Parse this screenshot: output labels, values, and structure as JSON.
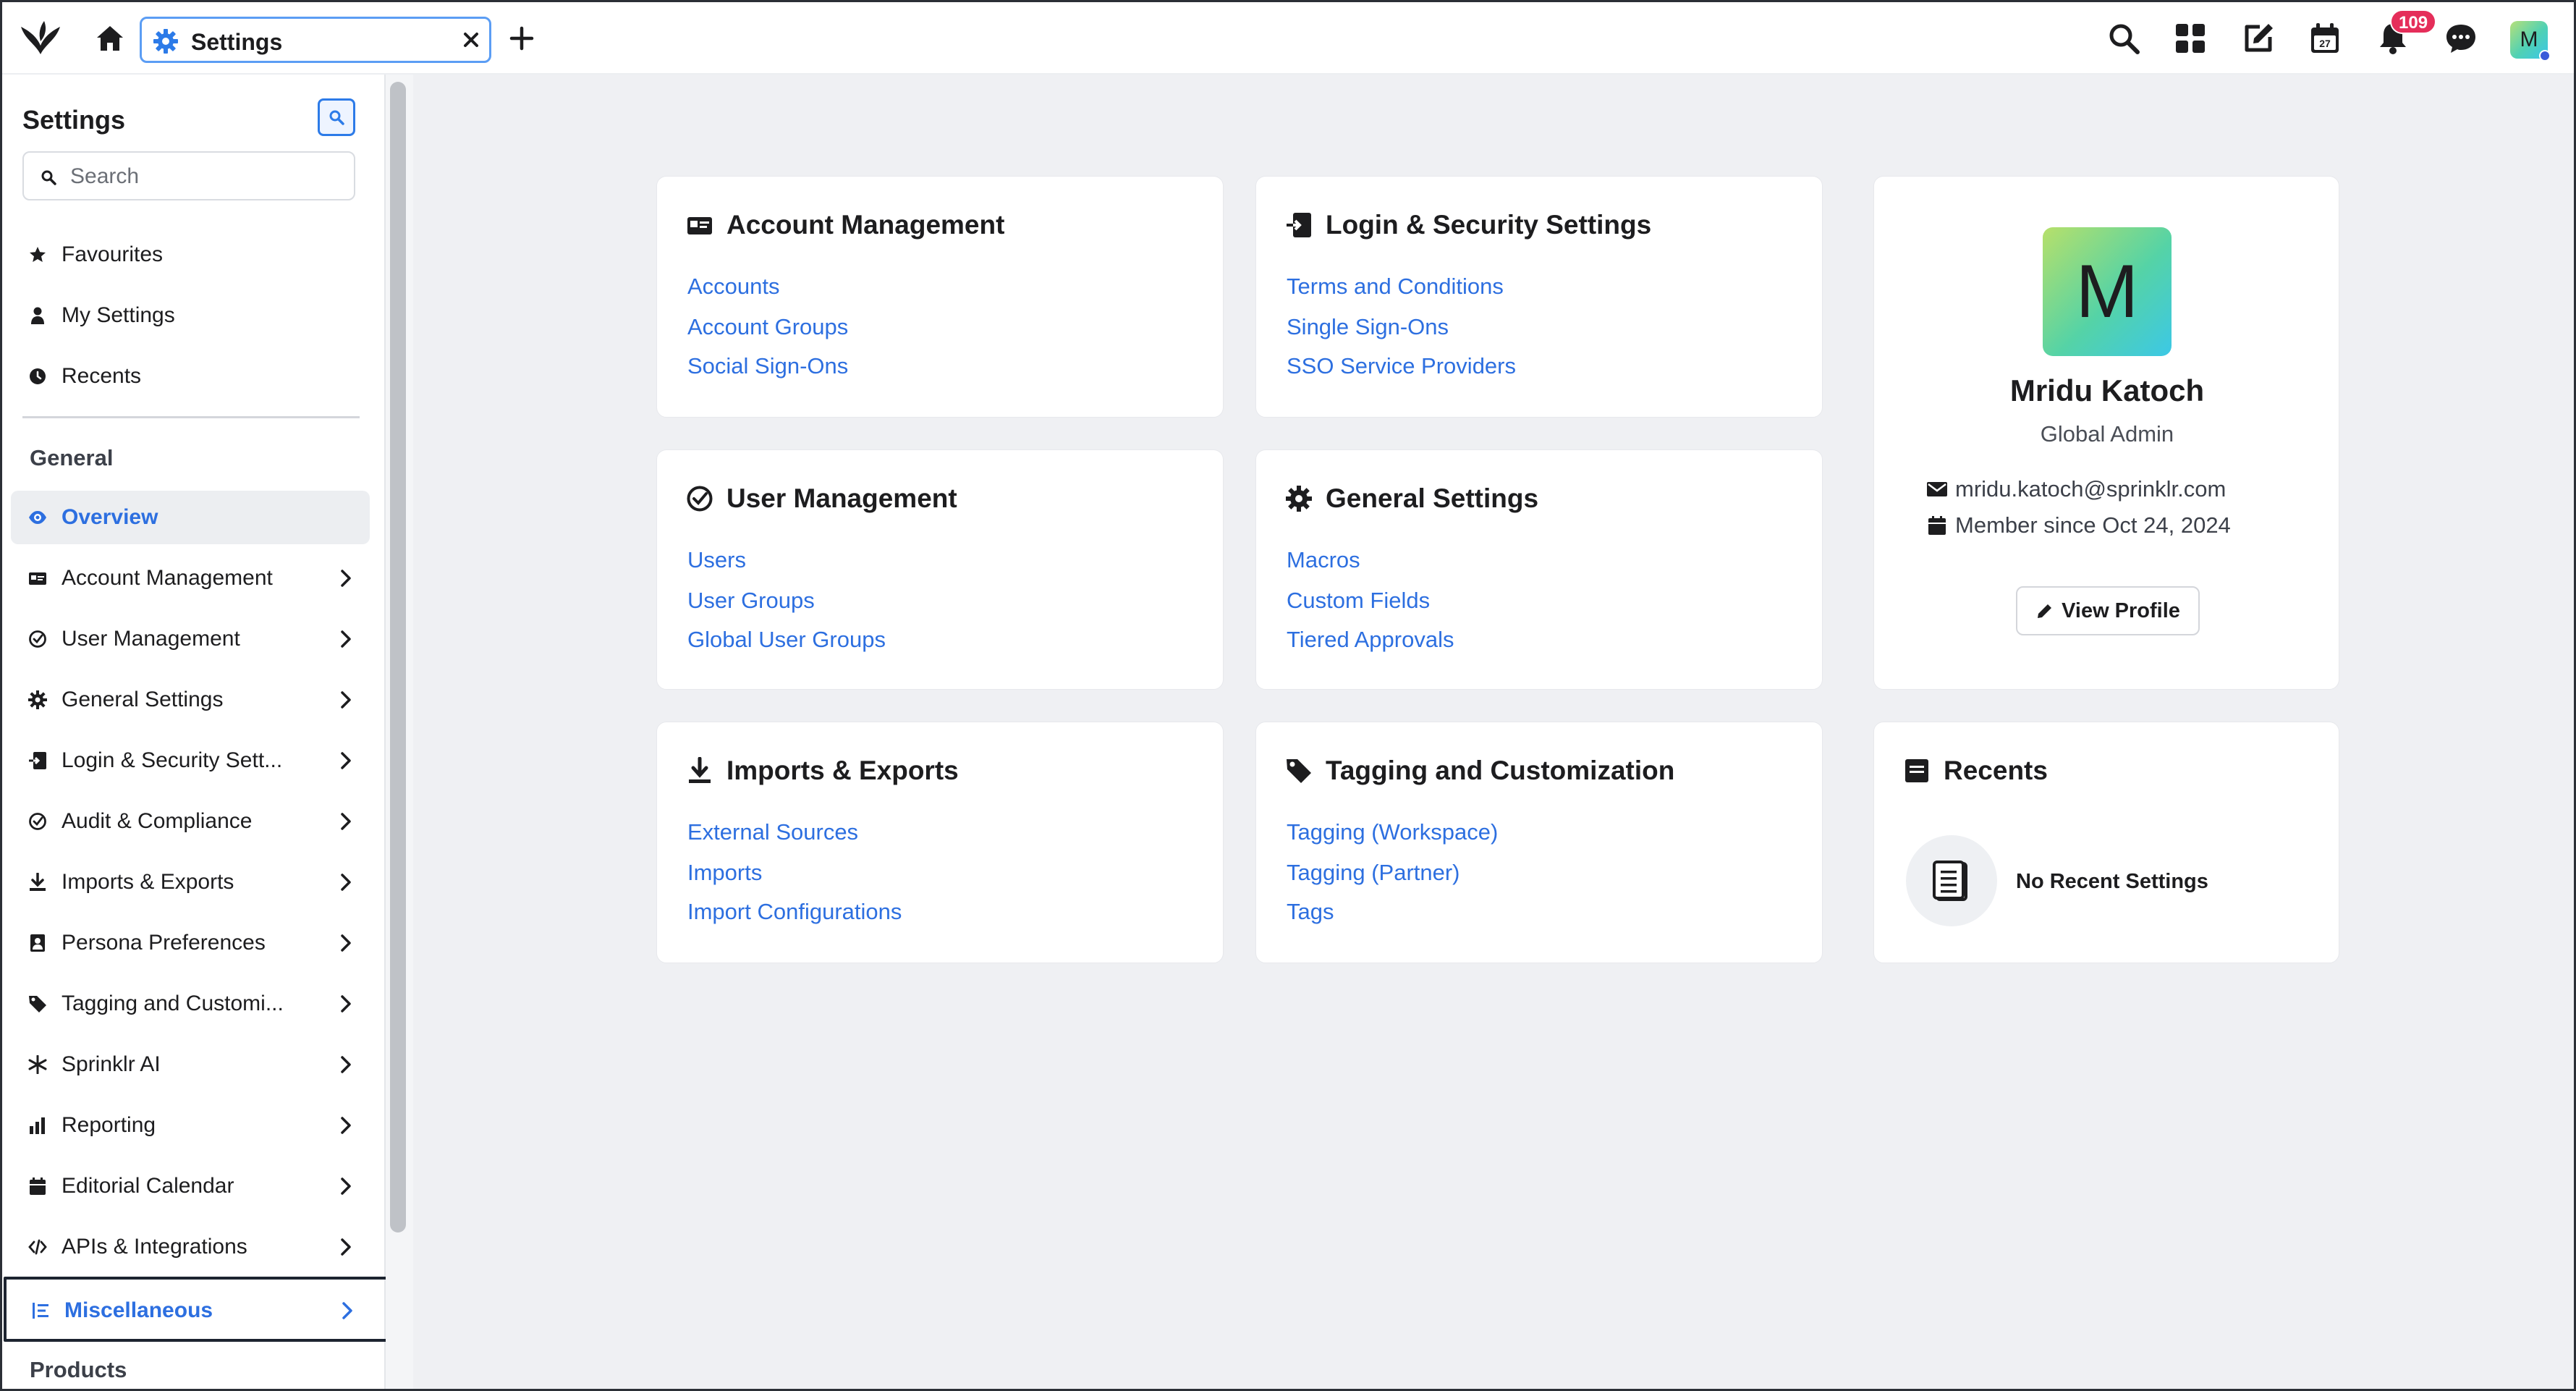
{
  "topbar": {
    "tab_title": "Settings",
    "notification_count": "109",
    "avatar_letter": "M",
    "calendar_day": "27"
  },
  "sidebar": {
    "title": "Settings",
    "search_placeholder": "Search",
    "quick_items": [
      {
        "label": "Favourites",
        "icon": "star-icon"
      },
      {
        "label": "My Settings",
        "icon": "person-icon"
      },
      {
        "label": "Recents",
        "icon": "clock-icon"
      }
    ],
    "section_general": "General",
    "items": [
      {
        "label": "Overview",
        "icon": "eye-icon",
        "state": "active"
      },
      {
        "label": "Account Management",
        "icon": "id-card-icon"
      },
      {
        "label": "User Management",
        "icon": "check-circle-icon"
      },
      {
        "label": "General Settings",
        "icon": "gear-icon"
      },
      {
        "label": "Login & Security Sett...",
        "icon": "login-icon"
      },
      {
        "label": "Audit & Compliance",
        "icon": "check-circle-icon"
      },
      {
        "label": "Imports & Exports",
        "icon": "download-icon"
      },
      {
        "label": "Persona Preferences",
        "icon": "persona-icon"
      },
      {
        "label": "Tagging and Customi...",
        "icon": "tag-icon"
      },
      {
        "label": "Sprinklr AI",
        "icon": "asterisk-icon"
      },
      {
        "label": "Reporting",
        "icon": "bar-chart-icon"
      },
      {
        "label": "Editorial Calendar",
        "icon": "calendar-icon"
      },
      {
        "label": "APIs & Integrations",
        "icon": "code-icon"
      },
      {
        "label": "Miscellaneous",
        "icon": "list-icon",
        "state": "focused"
      }
    ],
    "section_products": "Products"
  },
  "cards": {
    "account_management": {
      "title": "Account Management",
      "links": [
        "Accounts",
        "Account Groups",
        "Social Sign-Ons"
      ]
    },
    "login_security": {
      "title": "Login & Security Settings",
      "links": [
        "Terms and Conditions",
        "Single Sign-Ons",
        "SSO Service Providers"
      ]
    },
    "user_management": {
      "title": "User Management",
      "links": [
        "Users",
        "User Groups",
        "Global User Groups"
      ]
    },
    "general_settings": {
      "title": "General Settings",
      "links": [
        "Macros",
        "Custom Fields",
        "Tiered Approvals"
      ]
    },
    "imports_exports": {
      "title": "Imports & Exports",
      "links": [
        "External Sources",
        "Imports",
        "Import Configurations"
      ]
    },
    "tagging": {
      "title": "Tagging and Customization",
      "links": [
        "Tagging (Workspace)",
        "Tagging (Partner)",
        "Tags"
      ]
    }
  },
  "profile": {
    "avatar_letter": "M",
    "name": "Mridu Katoch",
    "role": "Global Admin",
    "email": "mridu.katoch@sprinklr.com",
    "member_since": "Member since Oct 24, 2024",
    "view_profile_label": "View Profile"
  },
  "recents": {
    "title": "Recents",
    "empty_text": "No Recent Settings"
  },
  "colors": {
    "accent": "#2d6fe0",
    "badge": "#e52e5a",
    "main_bg": "#eff0f3"
  }
}
